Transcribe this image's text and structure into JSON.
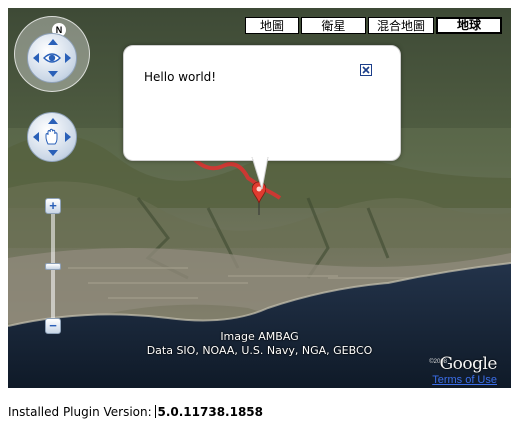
{
  "map_types": [
    {
      "label": "地圖",
      "active": false
    },
    {
      "label": "衛星",
      "active": false
    },
    {
      "label": "混合地圖",
      "active": false
    },
    {
      "label": "地球",
      "active": true
    }
  ],
  "compass": {
    "north_label": "N"
  },
  "info_window": {
    "text": "Hello world!"
  },
  "attribution": {
    "line1": "Image AMBAG",
    "line2": "Data SIO, NOAA, U.S. Navy, NGA, GEBCO",
    "logo": "Google",
    "logo_year": "©2008",
    "terms": "Terms of Use"
  },
  "plugin": {
    "label": "Installed Plugin Version:",
    "version": "5.0.11738.1858"
  },
  "icons": [
    "eye-icon",
    "hand-icon",
    "close-icon",
    "zoom-in-icon",
    "zoom-out-icon"
  ],
  "colors": {
    "accent": "#2a60b8",
    "terms_link": "#3b6ee8",
    "marker": "#e03b2f",
    "path": "#e03030",
    "ocean": "#1c2a3c"
  }
}
